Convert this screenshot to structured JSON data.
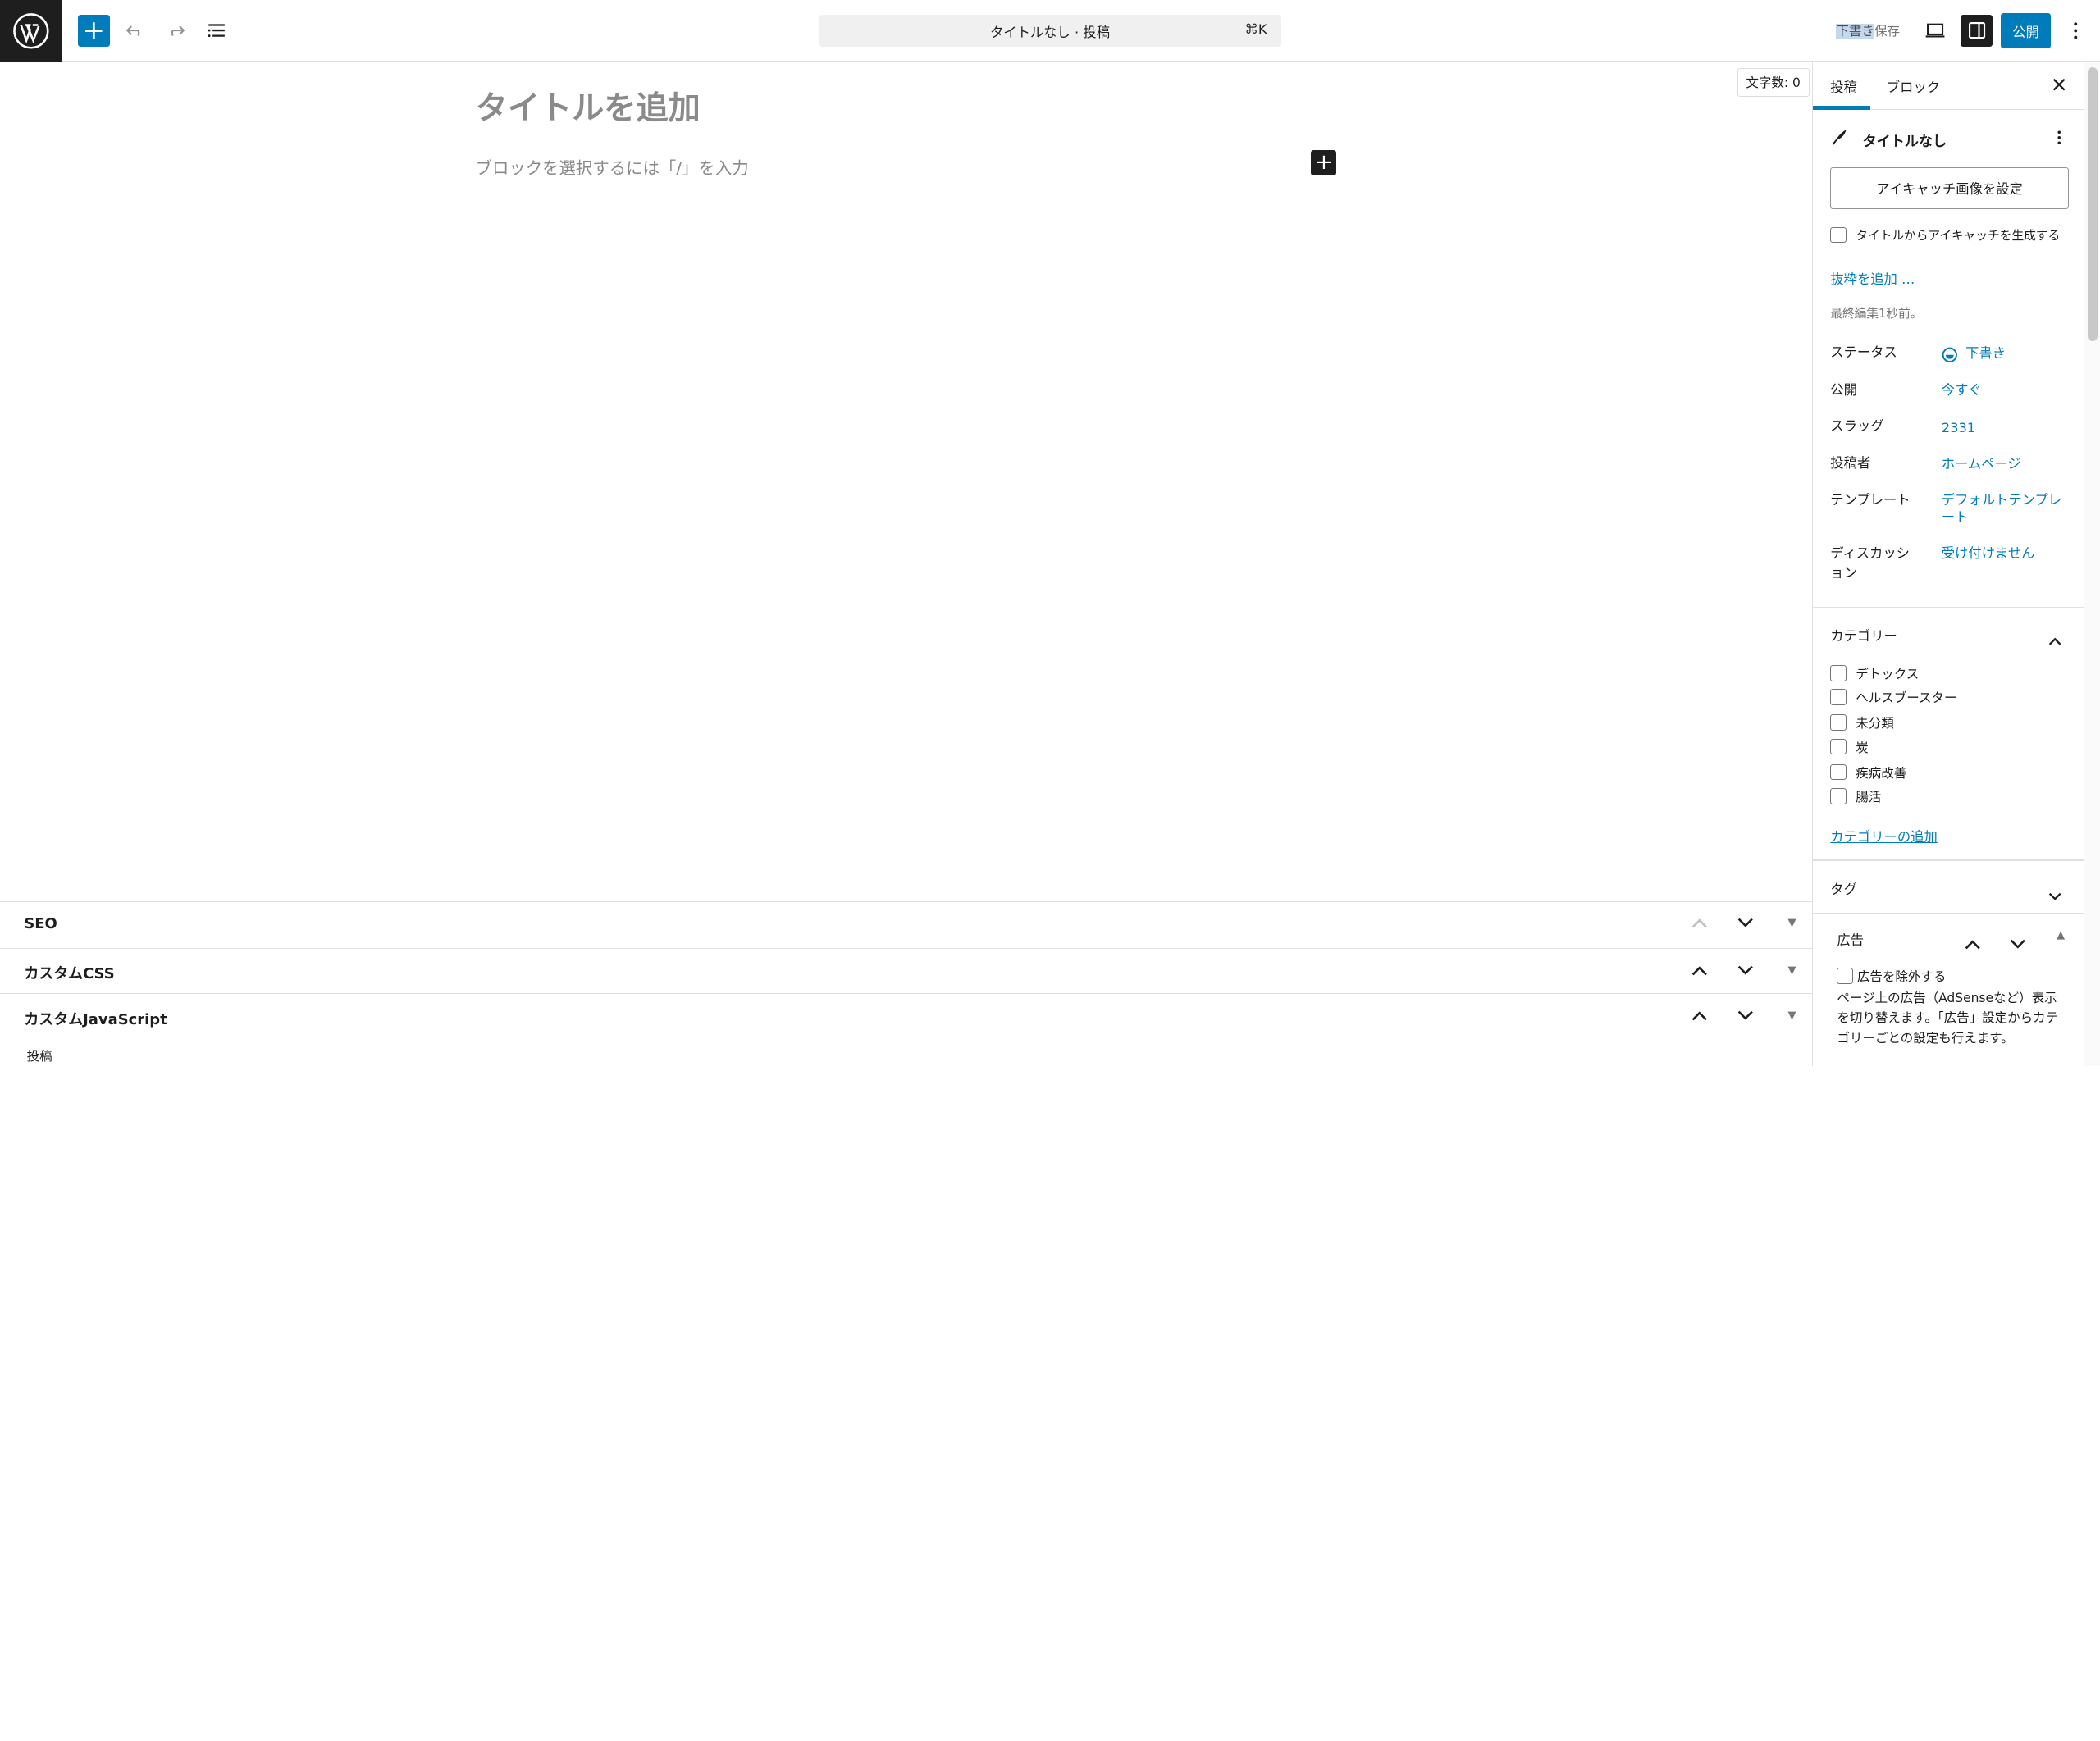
{
  "topbar": {
    "document_title": "タイトルなし · 投稿",
    "shortcut": "⌘K",
    "save_draft_highlighted": "下書き",
    "save_draft_rest": "保存",
    "publish_label": "公開"
  },
  "editor": {
    "word_count": "文字数: 0",
    "title_placeholder": "タイトルを追加",
    "block_placeholder": "ブロックを選択するには「/」を入力"
  },
  "metaboxes": [
    {
      "label": "SEO"
    },
    {
      "label": "カスタムCSS"
    },
    {
      "label": "カスタムJavaScript"
    }
  ],
  "statusbar": {
    "breadcrumb": "投稿"
  },
  "sidebar": {
    "tabs": [
      "投稿",
      "ブロック"
    ],
    "post_title": "タイトルなし",
    "featured_image_button": "アイキャッチ画像を設定",
    "generate_from_title": "タイトルからアイキャッチを生成する",
    "add_excerpt": "抜粋を追加 …",
    "last_edited": "最終編集1秒前。",
    "properties": [
      {
        "label": "ステータス",
        "value": "下書き"
      },
      {
        "label": "公開",
        "value": "今すぐ"
      },
      {
        "label": "スラッグ",
        "value": "2331"
      },
      {
        "label": "投稿者",
        "value": "ホームページ"
      },
      {
        "label": "テンプレート",
        "value": "デフォルトテンプレート"
      },
      {
        "label": "ディスカッション",
        "value": "受け付けません"
      }
    ],
    "categories_title": "カテゴリー",
    "categories": [
      "デトックス",
      "ヘルスブースター",
      "未分類",
      "炭",
      "疾病改善",
      "腸活"
    ],
    "add_category": "カテゴリーの追加",
    "tags_title": "タグ",
    "ads_title": "広告",
    "exclude_ads": "広告を除外する",
    "ads_description": "ページ上の広告（AdSenseなど）表示を切り替えます。「広告」設定からカテゴリーごとの設定も行えます。"
  }
}
